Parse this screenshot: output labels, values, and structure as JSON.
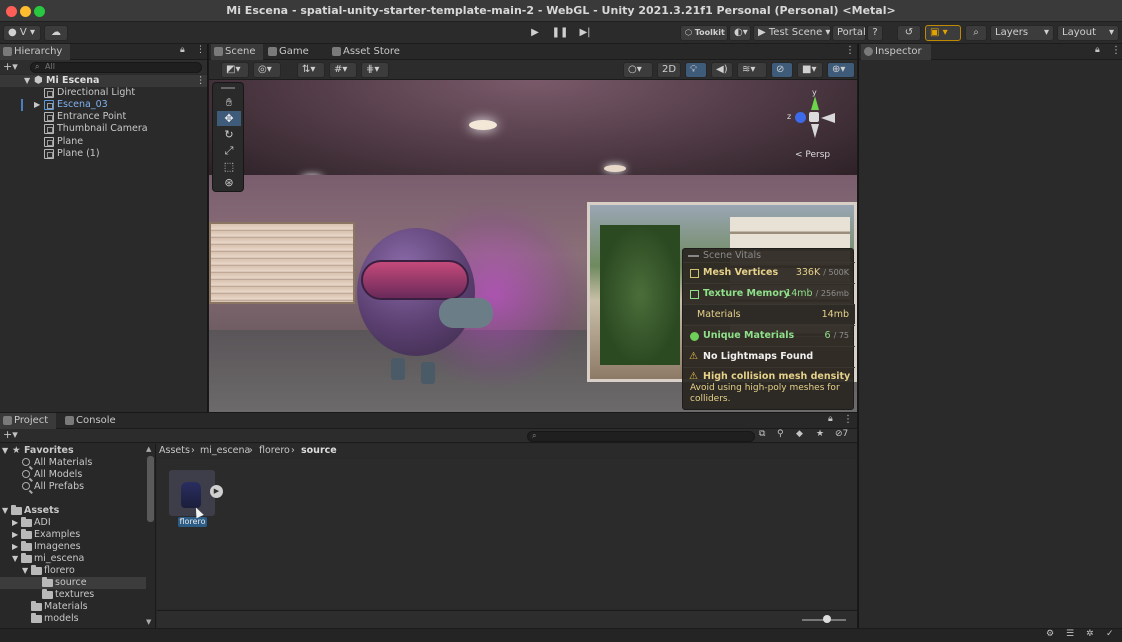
{
  "window": {
    "title": "Mi Escena - spatial-unity-starter-template-main-2 - WebGL - Unity 2021.3.21f1 Personal (Personal) <Metal>"
  },
  "toolbar": {
    "account_label": "V",
    "toolkit_label": "Toolkit",
    "test_scene_label": "Test Scene",
    "portal_label": "Portal",
    "layers_label": "Layers",
    "layout_label": "Layout"
  },
  "hierarchy": {
    "tab": "Hierarchy",
    "search_placeholder": "All",
    "scene_name": "Mi Escena",
    "items": [
      {
        "label": "Directional Light"
      },
      {
        "label": "Escena_03"
      },
      {
        "label": "Entrance Point"
      },
      {
        "label": "Thumbnail Camera"
      },
      {
        "label": "Plane"
      },
      {
        "label": "Plane (1)"
      }
    ]
  },
  "scene_tabs": [
    {
      "label": "Scene"
    },
    {
      "label": "Game"
    },
    {
      "label": "Asset Store"
    }
  ],
  "scene_toolbar": {
    "mode_2d": "2D"
  },
  "gizmo": {
    "persp_label": "< Persp",
    "axis_y": "y",
    "axis_z": "z"
  },
  "scene_vitals": {
    "title": "Scene Vitals",
    "rows": [
      {
        "label": "Mesh Vertices",
        "value": "336K",
        "max": "/ 500K"
      },
      {
        "label": "Texture Memory",
        "value": "14mb",
        "max": "/ 256mb"
      },
      {
        "label": "Materials",
        "value": "14mb",
        "max": ""
      },
      {
        "label": "Unique Materials",
        "value": "6",
        "max": "/ 75"
      }
    ],
    "warning1": "No Lightmaps Found",
    "warning2_title": "High collision mesh density",
    "warning2_text": "Avoid using high-poly meshes for colliders."
  },
  "inspector": {
    "tab": "Inspector"
  },
  "project": {
    "tabs": [
      {
        "label": "Project"
      },
      {
        "label": "Console"
      }
    ],
    "favorites_label": "Favorites",
    "favorites": [
      {
        "label": "All Materials"
      },
      {
        "label": "All Models"
      },
      {
        "label": "All Prefabs"
      }
    ],
    "assets_label": "Assets",
    "folders": [
      {
        "label": "ADI"
      },
      {
        "label": "Examples"
      },
      {
        "label": "Imagenes"
      },
      {
        "label": "mi_escena"
      },
      {
        "label": "florero"
      },
      {
        "label": "source"
      },
      {
        "label": "textures"
      },
      {
        "label": "Materials"
      },
      {
        "label": "models"
      }
    ],
    "breadcrumb": [
      "Assets",
      "mi_escena",
      "florero",
      "source"
    ],
    "layer_count": "7",
    "asset_label": "florero"
  },
  "colors": {
    "accent": "#2c5d87",
    "vitals_text": "#e6d28a",
    "unique_text": "#8fe08a"
  }
}
